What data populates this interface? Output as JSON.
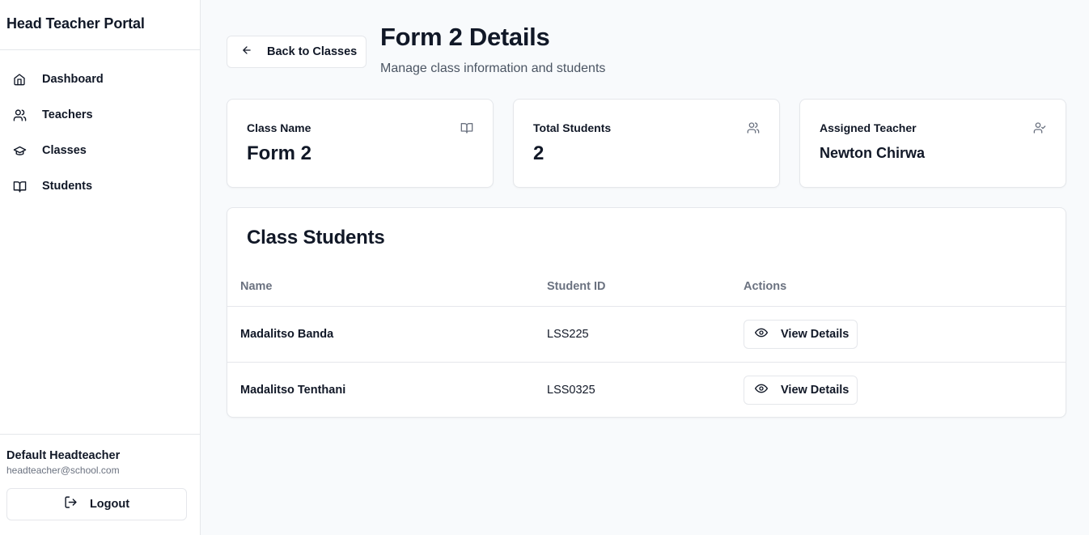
{
  "sidebar": {
    "title": "Head Teacher Portal",
    "items": [
      {
        "label": "Dashboard",
        "icon": "home-icon"
      },
      {
        "label": "Teachers",
        "icon": "users-icon"
      },
      {
        "label": "Classes",
        "icon": "graduation-cap-icon"
      },
      {
        "label": "Students",
        "icon": "book-open-icon"
      }
    ],
    "user": {
      "name": "Default Headteacher",
      "email": "headteacher@school.com"
    },
    "logout_label": "Logout"
  },
  "header": {
    "back_label": "Back to Classes",
    "title": "Form 2 Details",
    "subtitle": "Manage class information and students"
  },
  "stats": [
    {
      "label": "Class Name",
      "value": "Form 2",
      "icon": "book-open-icon"
    },
    {
      "label": "Total Students",
      "value": "2",
      "icon": "users-icon"
    },
    {
      "label": "Assigned Teacher",
      "value": "Newton Chirwa",
      "icon": "user-check-icon"
    }
  ],
  "students_table": {
    "title": "Class Students",
    "columns": [
      "Name",
      "Student ID",
      "Actions"
    ],
    "rows": [
      {
        "name": "Madalitso Banda",
        "id": "LSS225",
        "action": "View Details"
      },
      {
        "name": "Madalitso Tenthani",
        "id": "LSS0325",
        "action": "View Details"
      }
    ]
  },
  "colors": {
    "text": "#111827",
    "muted": "#6b7280",
    "border": "#e5e7eb",
    "background": "#f8fafc"
  }
}
